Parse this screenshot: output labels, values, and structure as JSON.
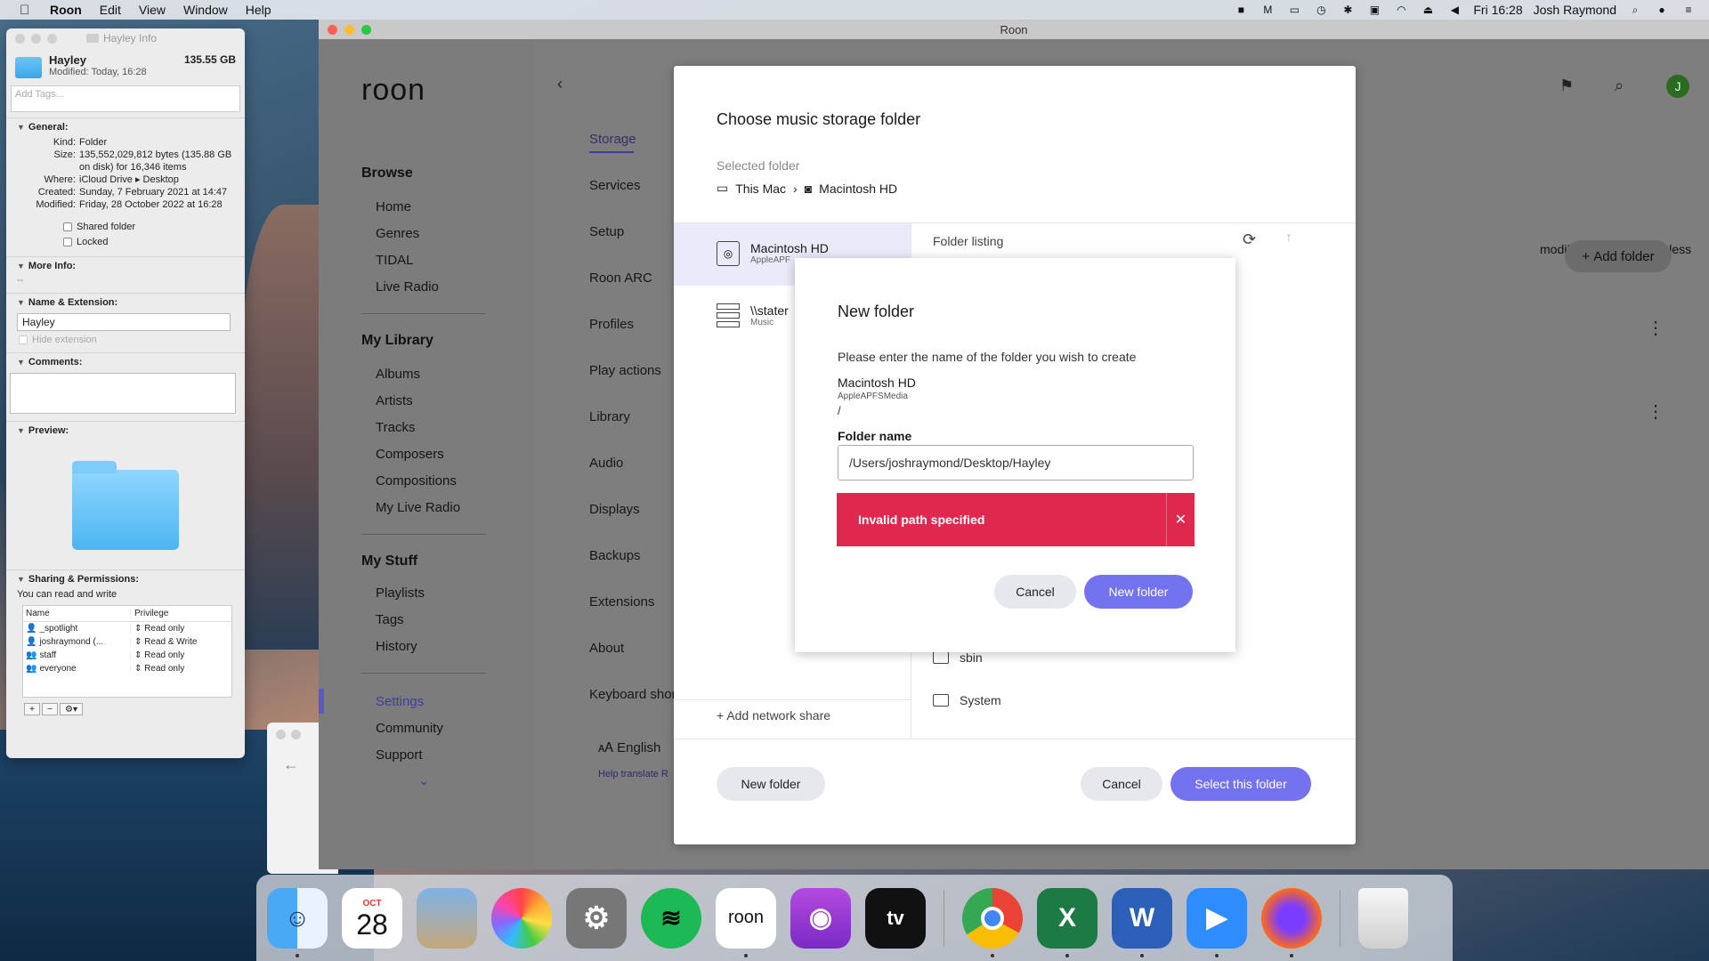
{
  "menubar": {
    "app": "Roon",
    "menus": [
      "Edit",
      "View",
      "Window",
      "Help"
    ],
    "clock": "Fri 16:28",
    "user": "Josh Raymond"
  },
  "info_window": {
    "title": "Hayley Info",
    "name": "Hayley",
    "size": "135.55 GB",
    "modified_short": "Modified: Today, 16:28",
    "tags_placeholder": "Add Tags...",
    "general": {
      "heading": "General:",
      "kind_k": "Kind:",
      "kind_v": "Folder",
      "size_k": "Size:",
      "size_v": "135,552,029,812 bytes (135.88 GB on disk) for 16,346 items",
      "where_k": "Where:",
      "where_v": "iCloud Drive ▸ Desktop",
      "created_k": "Created:",
      "created_v": "Sunday, 7 February 2021 at 14:47",
      "modified_k": "Modified:",
      "modified_v": "Friday, 28 October 2022 at 16:28",
      "shared": "Shared folder",
      "locked": "Locked"
    },
    "more_info": {
      "heading": "More Info:",
      "value": "--"
    },
    "name_ext": {
      "heading": "Name & Extension:",
      "value": "Hayley",
      "hide": "Hide extension"
    },
    "comments": {
      "heading": "Comments:"
    },
    "preview": {
      "heading": "Preview:"
    },
    "sharing": {
      "heading": "Sharing & Permissions:",
      "note": "You can read and write",
      "col_name": "Name",
      "col_priv": "Privilege",
      "rows": [
        {
          "name": "_spotlight",
          "priv": "Read only"
        },
        {
          "name": "joshraymond (...",
          "priv": "Read & Write"
        },
        {
          "name": "staff",
          "priv": "Read only"
        },
        {
          "name": "everyone",
          "priv": "Read only"
        }
      ]
    }
  },
  "roon": {
    "window_title": "Roon",
    "logo": "roon",
    "nav": {
      "browse": "Browse",
      "browse_items": [
        "Home",
        "Genres",
        "TIDAL",
        "Live Radio"
      ],
      "library": "My Library",
      "library_items": [
        "Albums",
        "Artists",
        "Tracks",
        "Composers",
        "Compositions",
        "My Live Radio"
      ],
      "stuff": "My Stuff",
      "stuff_items": [
        "Playlists",
        "Tags",
        "History"
      ],
      "bottom_items": [
        "Settings",
        "Community",
        "Support"
      ]
    },
    "settings_tabs": [
      "Storage",
      "Services",
      "Setup",
      "Roon ARC",
      "Profiles",
      "Play actions",
      "Library",
      "Audio",
      "Displays",
      "Backups",
      "Extensions",
      "About",
      "Keyboard shor"
    ],
    "language": "English",
    "help_translate": "Help translate R",
    "bg_text": "modified in any way, unless",
    "add_folder": "Add folder",
    "avatar": "J"
  },
  "dialog": {
    "title": "Choose music storage folder",
    "selected_label": "Selected folder",
    "crumb_1": "This Mac",
    "crumb_2": "Macintosh HD",
    "volumes": [
      {
        "name": "Macintosh HD",
        "sub": "AppleAPF"
      },
      {
        "name": "\\\\stater",
        "sub": "Music"
      }
    ],
    "add_network": "Add network share",
    "listing_label": "Folder listing",
    "folders": [
      "sbin",
      "System"
    ],
    "new_folder_btn": "New folder",
    "cancel_btn": "Cancel",
    "select_btn": "Select this folder"
  },
  "modal": {
    "title": "New folder",
    "prompt": "Please enter the name of the folder you wish to create",
    "volume": "Macintosh HD",
    "volume_sub": "AppleAPFSMedia",
    "path": "/",
    "field_label": "Folder name",
    "field_value": "/Users/joshraymond/Desktop/Hayley",
    "error": "Invalid path specified",
    "cancel": "Cancel",
    "create": "New folder"
  },
  "dock": {
    "calendar_month": "OCT",
    "calendar_day": "28",
    "roon_label": "roon",
    "tv_label": "tv"
  }
}
